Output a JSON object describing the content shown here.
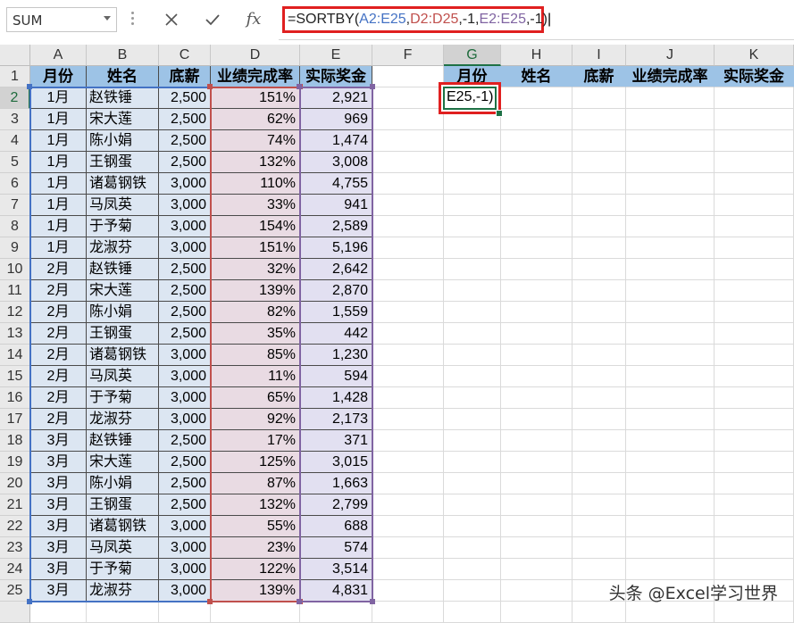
{
  "name_box": {
    "value": "SUM"
  },
  "formula_bar": {
    "cancel_icon": "close-icon",
    "enter_icon": "check-icon",
    "fx_label": "fx",
    "segments": [
      {
        "text": "=SORTBY(",
        "color": "#222222"
      },
      {
        "text": "A2:E25",
        "color": "#4472c4"
      },
      {
        "text": ",",
        "color": "#222222"
      },
      {
        "text": "D2:D25",
        "color": "#c0504d"
      },
      {
        "text": ",-1,",
        "color": "#222222"
      },
      {
        "text": "E2:E25",
        "color": "#8064a2"
      },
      {
        "text": ",-1)",
        "color": "#222222"
      }
    ]
  },
  "columns": [
    "A",
    "B",
    "C",
    "D",
    "E",
    "F",
    "G",
    "H",
    "I",
    "J",
    "K"
  ],
  "selected_column": "G",
  "selected_row": "2",
  "rows": [
    "1",
    "2",
    "3",
    "4",
    "5",
    "6",
    "7",
    "8",
    "9",
    "10",
    "11",
    "12",
    "13",
    "14",
    "15",
    "16",
    "17",
    "18",
    "19",
    "20",
    "21",
    "22",
    "23",
    "24",
    "25",
    ""
  ],
  "table_headers": [
    "月份",
    "姓名",
    "底薪",
    "业绩完成率",
    "实际奖金"
  ],
  "output_headers": [
    "月份",
    "姓名",
    "底薪",
    "业绩完成率",
    "实际奖金"
  ],
  "active_cell_text": "E25,-1)",
  "data_rows": [
    [
      "1月",
      "赵铁锤",
      "2,500",
      "151%",
      "2,921"
    ],
    [
      "1月",
      "宋大莲",
      "2,500",
      "62%",
      "969"
    ],
    [
      "1月",
      "陈小娟",
      "2,500",
      "74%",
      "1,474"
    ],
    [
      "1月",
      "王钢蛋",
      "2,500",
      "132%",
      "3,008"
    ],
    [
      "1月",
      "诸葛钢铁",
      "3,000",
      "110%",
      "4,755"
    ],
    [
      "1月",
      "马凤英",
      "3,000",
      "33%",
      "941"
    ],
    [
      "1月",
      "于予菊",
      "3,000",
      "154%",
      "2,589"
    ],
    [
      "1月",
      "龙淑芬",
      "3,000",
      "151%",
      "5,196"
    ],
    [
      "2月",
      "赵铁锤",
      "2,500",
      "32%",
      "2,642"
    ],
    [
      "2月",
      "宋大莲",
      "2,500",
      "139%",
      "2,870"
    ],
    [
      "2月",
      "陈小娟",
      "2,500",
      "82%",
      "1,559"
    ],
    [
      "2月",
      "王钢蛋",
      "2,500",
      "35%",
      "442"
    ],
    [
      "2月",
      "诸葛钢铁",
      "3,000",
      "85%",
      "1,230"
    ],
    [
      "2月",
      "马凤英",
      "3,000",
      "11%",
      "594"
    ],
    [
      "2月",
      "于予菊",
      "3,000",
      "65%",
      "1,428"
    ],
    [
      "2月",
      "龙淑芬",
      "3,000",
      "92%",
      "2,173"
    ],
    [
      "3月",
      "赵铁锤",
      "2,500",
      "17%",
      "371"
    ],
    [
      "3月",
      "宋大莲",
      "2,500",
      "125%",
      "3,015"
    ],
    [
      "3月",
      "陈小娟",
      "2,500",
      "87%",
      "1,663"
    ],
    [
      "3月",
      "王钢蛋",
      "2,500",
      "132%",
      "2,799"
    ],
    [
      "3月",
      "诸葛钢铁",
      "3,000",
      "55%",
      "688"
    ],
    [
      "3月",
      "马凤英",
      "3,000",
      "23%",
      "574"
    ],
    [
      "3月",
      "于予菊",
      "3,000",
      "122%",
      "3,514"
    ],
    [
      "3月",
      "龙淑芬",
      "3,000",
      "139%",
      "4,831"
    ]
  ],
  "watermark": "头条 @Excel学习世界",
  "colors": {
    "header_fill": "#9dc3e6",
    "ref_a": "#4472c4",
    "ref_d": "#c0504d",
    "ref_e": "#8064a2",
    "highlight_red": "#e02020",
    "excel_green": "#1e7145"
  }
}
